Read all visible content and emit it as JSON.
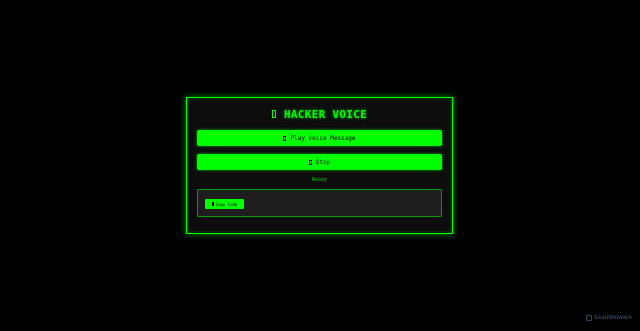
{
  "panel": {
    "title": "HACKER VOICE",
    "title_icon": "glyph-icon",
    "play_button": {
      "label": "Play Voice Message",
      "icon": "glyph-icon"
    },
    "stop_button": {
      "label": "Stop",
      "icon": "glyph-icon"
    },
    "status": "Ready",
    "code_box": {
      "copy_button": {
        "label": "Copy Code",
        "icon": "glyph-icon"
      }
    }
  },
  "watermark": {
    "text": "ScanMalware"
  },
  "colors": {
    "background": "#000000",
    "accent": "#00ff00",
    "panel_bg": "#0d0d0d",
    "code_box_bg": "#1e1e1e"
  }
}
